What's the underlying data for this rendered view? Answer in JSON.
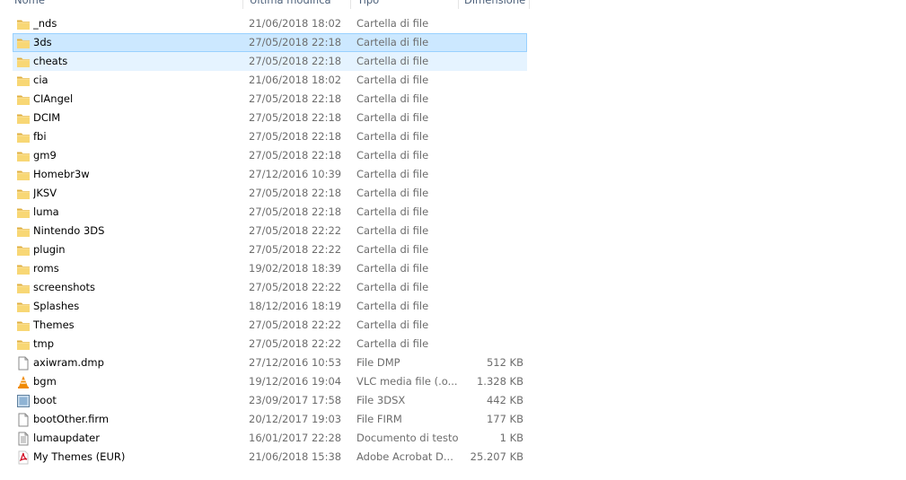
{
  "columns": {
    "name": "Nome",
    "date": "Ultima modifica",
    "type": "Tipo",
    "size": "Dimensione"
  },
  "files": [
    {
      "name": "_nds",
      "date": "21/06/2018 18:02",
      "type": "Cartella di file",
      "size": "",
      "icon": "folder-icon",
      "state": ""
    },
    {
      "name": "3ds",
      "date": "27/05/2018 22:18",
      "type": "Cartella di file",
      "size": "",
      "icon": "folder-icon",
      "state": "selected"
    },
    {
      "name": "cheats",
      "date": "27/05/2018 22:18",
      "type": "Cartella di file",
      "size": "",
      "icon": "folder-icon",
      "state": "hover"
    },
    {
      "name": "cia",
      "date": "21/06/2018 18:02",
      "type": "Cartella di file",
      "size": "",
      "icon": "folder-icon",
      "state": ""
    },
    {
      "name": "CIAngel",
      "date": "27/05/2018 22:18",
      "type": "Cartella di file",
      "size": "",
      "icon": "folder-icon",
      "state": ""
    },
    {
      "name": "DCIM",
      "date": "27/05/2018 22:18",
      "type": "Cartella di file",
      "size": "",
      "icon": "folder-icon",
      "state": ""
    },
    {
      "name": "fbi",
      "date": "27/05/2018 22:18",
      "type": "Cartella di file",
      "size": "",
      "icon": "folder-icon",
      "state": ""
    },
    {
      "name": "gm9",
      "date": "27/05/2018 22:18",
      "type": "Cartella di file",
      "size": "",
      "icon": "folder-icon",
      "state": ""
    },
    {
      "name": "Homebr3w",
      "date": "27/12/2016 10:39",
      "type": "Cartella di file",
      "size": "",
      "icon": "folder-icon",
      "state": ""
    },
    {
      "name": "JKSV",
      "date": "27/05/2018 22:18",
      "type": "Cartella di file",
      "size": "",
      "icon": "folder-icon",
      "state": ""
    },
    {
      "name": "luma",
      "date": "27/05/2018 22:18",
      "type": "Cartella di file",
      "size": "",
      "icon": "folder-icon",
      "state": ""
    },
    {
      "name": "Nintendo 3DS",
      "date": "27/05/2018 22:22",
      "type": "Cartella di file",
      "size": "",
      "icon": "folder-icon",
      "state": ""
    },
    {
      "name": "plugin",
      "date": "27/05/2018 22:22",
      "type": "Cartella di file",
      "size": "",
      "icon": "folder-icon",
      "state": ""
    },
    {
      "name": "roms",
      "date": "19/02/2018 18:39",
      "type": "Cartella di file",
      "size": "",
      "icon": "folder-icon",
      "state": ""
    },
    {
      "name": "screenshots",
      "date": "27/05/2018 22:22",
      "type": "Cartella di file",
      "size": "",
      "icon": "folder-icon",
      "state": ""
    },
    {
      "name": "Splashes",
      "date": "18/12/2016 18:19",
      "type": "Cartella di file",
      "size": "",
      "icon": "folder-icon",
      "state": ""
    },
    {
      "name": "Themes",
      "date": "27/05/2018 22:22",
      "type": "Cartella di file",
      "size": "",
      "icon": "folder-icon",
      "state": ""
    },
    {
      "name": "tmp",
      "date": "27/05/2018 22:22",
      "type": "Cartella di file",
      "size": "",
      "icon": "folder-icon",
      "state": ""
    },
    {
      "name": "axiwram.dmp",
      "date": "27/12/2016 10:53",
      "type": "File DMP",
      "size": "512 KB",
      "icon": "file-icon",
      "state": ""
    },
    {
      "name": "bgm",
      "date": "19/12/2016 19:04",
      "type": "VLC media file (.o...",
      "size": "1.328 KB",
      "icon": "vlc-icon",
      "state": ""
    },
    {
      "name": "boot",
      "date": "23/09/2017 17:58",
      "type": "File 3DSX",
      "size": "442 KB",
      "icon": "app-icon",
      "state": ""
    },
    {
      "name": "bootOther.firm",
      "date": "20/12/2017 19:03",
      "type": "File FIRM",
      "size": "177 KB",
      "icon": "file-icon",
      "state": ""
    },
    {
      "name": "lumaupdater",
      "date": "16/01/2017 22:28",
      "type": "Documento di testo",
      "size": "1 KB",
      "icon": "text-file-icon",
      "state": ""
    },
    {
      "name": "My Themes (EUR)",
      "date": "21/06/2018 15:38",
      "type": "Adobe Acrobat D...",
      "size": "25.207 KB",
      "icon": "pdf-icon",
      "state": ""
    }
  ],
  "colors": {
    "selected_bg": "#cce8ff",
    "selected_border": "#99d1ff",
    "hover_bg": "#e5f3ff",
    "folder": "#f8d775",
    "folder_dark": "#e0b042"
  }
}
